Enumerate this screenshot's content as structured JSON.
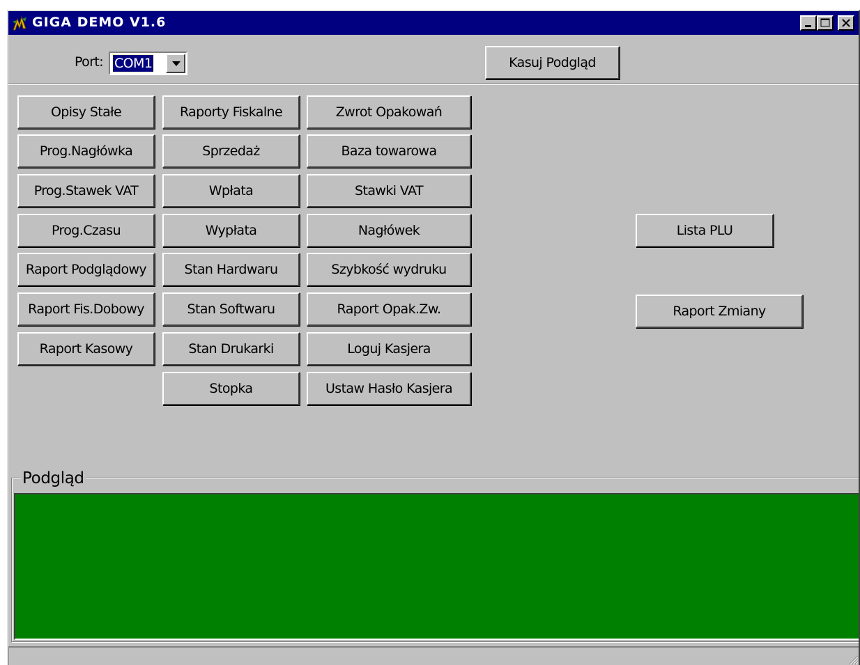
{
  "window": {
    "title": "GIGA DEMO V1.6",
    "controls": {
      "minimize": "minimize-icon",
      "maximize": "maximize-icon",
      "close": "close-icon"
    }
  },
  "toolbar": {
    "port_label": "Port:",
    "port_value": "COM1",
    "clear_preview": "Kasuj Podgląd"
  },
  "buttons": {
    "col1": [
      "Opisy Stałe",
      "Prog.Nagłówka",
      "Prog.Stawek VAT",
      "Prog.Czasu",
      "Raport Podglądowy",
      "Raport Fis.Dobowy",
      "Raport Kasowy"
    ],
    "col2": [
      "Raporty Fiskalne",
      "Sprzedaż",
      "Wpłata",
      "Wypłata",
      "Stan Hardwaru",
      "Stan Softwaru",
      "Stan Drukarki",
      "Stopka"
    ],
    "col3": [
      "Zwrot Opakowań",
      "Baza towarowa",
      "Stawki VAT",
      "Nagłówek",
      "Szybkość wydruku",
      "Raport Opak.Zw.",
      "Loguj Kasjera",
      "Ustaw Hasło Kasjera"
    ],
    "plu_list": "Lista PLU",
    "shift_report": "Raport Zmiany"
  },
  "preview": {
    "label": "Podgląd",
    "background": "#008000"
  },
  "colors": {
    "titlebar": "#000080",
    "face": "#c0c0c0"
  }
}
